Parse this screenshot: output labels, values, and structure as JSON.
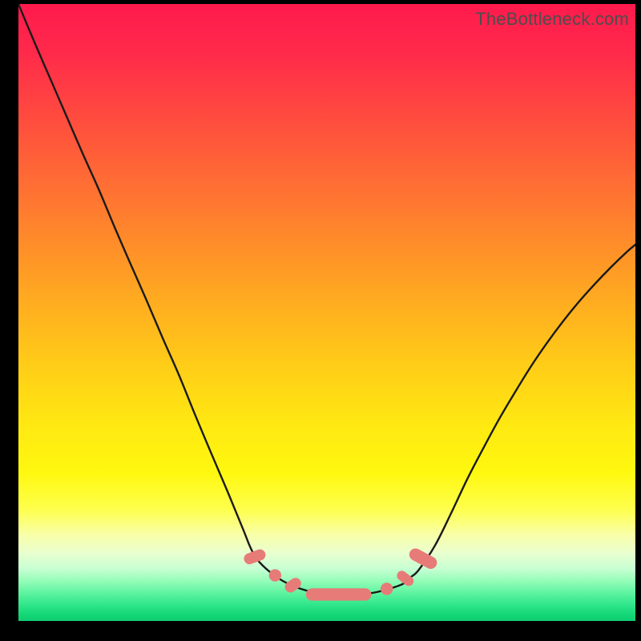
{
  "watermark": "TheBottleneck.com",
  "colors": {
    "frame": "#000000",
    "curve_stroke": "#1a1a1a",
    "marker_fill": "#e77b78",
    "gradient_top": "#ff1a4d",
    "gradient_bottom": "#0fce71"
  },
  "chart_data": {
    "type": "line",
    "title": "",
    "xlabel": "",
    "ylabel": "",
    "xlim": [
      0,
      100
    ],
    "ylim": [
      0,
      100
    ],
    "note": "No axes or tick labels are rendered. Values are estimated from pixel positions relative to the 770×770 plot area (x and y normalized to 0–100, y measured from bottom).",
    "series": [
      {
        "name": "left-curve",
        "x": [
          0.0,
          2.6,
          5.2,
          7.8,
          10.4,
          13.0,
          15.6,
          18.2,
          20.8,
          23.4,
          26.0,
          28.6,
          31.2,
          33.8,
          36.4,
          37.7,
          39.0,
          41.6,
          44.2,
          46.8,
          49.4,
          50.6,
          51.9
        ],
        "y": [
          100.0,
          93.8,
          87.8,
          81.8,
          75.8,
          70.0,
          63.8,
          57.8,
          51.9,
          45.8,
          39.9,
          33.5,
          27.3,
          21.2,
          14.9,
          11.7,
          9.6,
          7.3,
          5.8,
          4.9,
          4.4,
          4.3,
          4.2
        ]
      },
      {
        "name": "right-curve",
        "x": [
          51.9,
          54.5,
          57.1,
          59.7,
          62.3,
          63.6,
          64.9,
          67.5,
          70.1,
          72.7,
          75.3,
          77.9,
          80.5,
          83.1,
          85.7,
          88.3,
          90.9,
          93.5,
          96.1,
          98.7,
          100.0
        ],
        "y": [
          4.2,
          4.3,
          4.5,
          5.1,
          6.0,
          7.1,
          8.3,
          12.2,
          17.4,
          22.9,
          27.9,
          32.7,
          37.1,
          41.3,
          45.1,
          48.6,
          51.8,
          54.7,
          57.4,
          59.9,
          61.0
        ]
      }
    ],
    "markers": [
      {
        "shape": "capsule",
        "cx": 38.3,
        "cy": 10.4,
        "rx": 0.9,
        "ry": 1.8,
        "angle": 70
      },
      {
        "shape": "circle",
        "cx": 41.6,
        "cy": 7.4,
        "r": 1.0
      },
      {
        "shape": "capsule",
        "cx": 44.5,
        "cy": 5.8,
        "rx": 0.9,
        "ry": 1.4,
        "angle": 55
      },
      {
        "shape": "capsule",
        "cx": 51.9,
        "cy": 4.3,
        "rx": 5.3,
        "ry": 1.0,
        "angle": 0
      },
      {
        "shape": "circle",
        "cx": 59.7,
        "cy": 5.2,
        "r": 1.0
      },
      {
        "shape": "capsule",
        "cx": 62.7,
        "cy": 6.9,
        "rx": 0.8,
        "ry": 1.5,
        "angle": -52
      },
      {
        "shape": "capsule",
        "cx": 65.6,
        "cy": 10.1,
        "rx": 1.0,
        "ry": 2.4,
        "angle": -62
      }
    ]
  }
}
